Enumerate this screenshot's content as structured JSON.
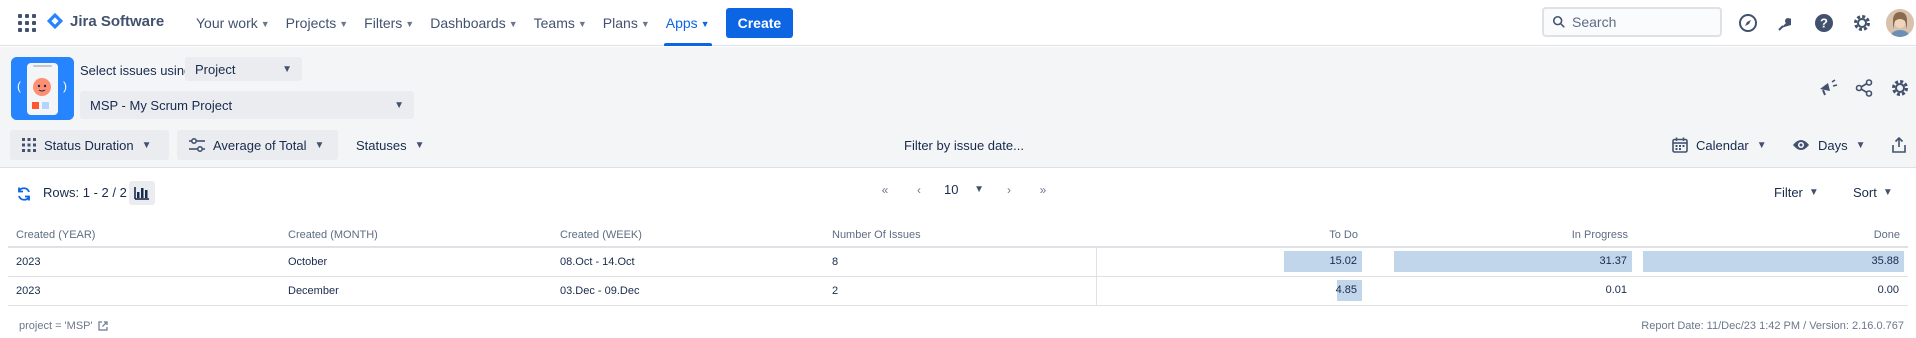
{
  "nav": {
    "product": "Jira Software",
    "items": [
      {
        "label": "Your work",
        "active": false
      },
      {
        "label": "Projects",
        "active": false
      },
      {
        "label": "Filters",
        "active": false
      },
      {
        "label": "Dashboards",
        "active": false
      },
      {
        "label": "Teams",
        "active": false
      },
      {
        "label": "Plans",
        "active": false
      },
      {
        "label": "Apps",
        "active": true
      }
    ],
    "create_label": "Create",
    "search_placeholder": "Search",
    "icons": [
      "compass-icon",
      "notification-icon",
      "help-icon",
      "settings-icon"
    ]
  },
  "header": {
    "select_label": "Select issues using",
    "source_value": "Project",
    "project_value": "MSP - My Scrum Project",
    "right_icons": [
      "megaphone-icon",
      "share-icon",
      "settings-icon"
    ]
  },
  "toolbar": {
    "status_duration": "Status Duration",
    "average": "Average of Total",
    "statuses": "Statuses",
    "filter_date": "Filter by issue date...",
    "calendar": "Calendar",
    "days": "Days"
  },
  "controls": {
    "rows": "Rows: 1 - 2 / 2",
    "page_size": "10",
    "filter": "Filter",
    "sort": "Sort"
  },
  "table": {
    "headers": [
      "Created (YEAR)",
      "Created (MONTH)",
      "Created (WEEK)",
      "Number Of Issues",
      "To Do",
      "In Progress",
      "Done"
    ],
    "rows": [
      {
        "year": "2023",
        "month": "October",
        "week": "08.Oct - 14.Oct",
        "issues": "8",
        "todo": "15.02",
        "inprogress": "31.37",
        "done": "35.88",
        "todo_fill": 0.3,
        "inprogress_fill": 0.91,
        "done_fill": 0.99
      },
      {
        "year": "2023",
        "month": "December",
        "week": "03.Dec - 09.Dec",
        "issues": "2",
        "todo": "4.85",
        "inprogress": "0.01",
        "done": "0.00",
        "todo_fill": 0.097,
        "inprogress_fill": 0,
        "done_fill": 0
      }
    ]
  },
  "footer": {
    "query": "project = 'MSP'",
    "report": "Report Date: 11/Dec/23 1:42 PM / Version: 2.16.0.767"
  }
}
